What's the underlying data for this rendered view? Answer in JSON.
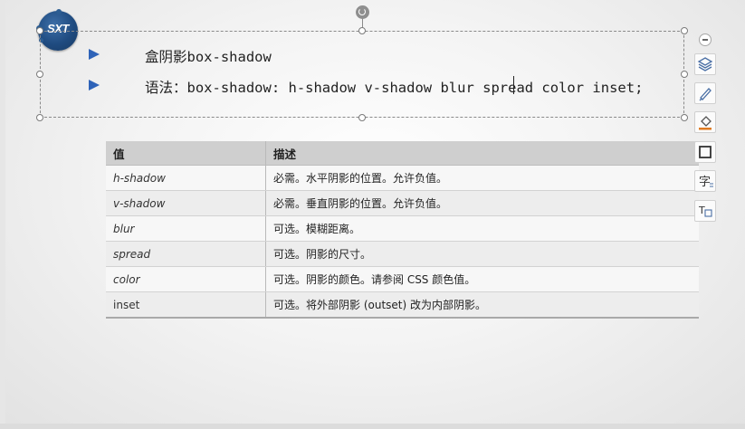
{
  "logo": {
    "text": "SXT"
  },
  "slide": {
    "bullets": [
      {
        "text": "盒阴影box-shadow"
      },
      {
        "text": "语法：box-shadow: h-shadow v-shadow blur spread color inset;"
      }
    ]
  },
  "table": {
    "headers": [
      "值",
      "描述"
    ],
    "rows": [
      {
        "value": "h-shadow",
        "desc": "必需。水平阴影的位置。允许负值。"
      },
      {
        "value": "v-shadow",
        "desc": "必需。垂直阴影的位置。允许负值。"
      },
      {
        "value": "blur",
        "desc": "可选。模糊距离。"
      },
      {
        "value": "spread",
        "desc": "可选。阴影的尺寸。"
      },
      {
        "value": "color",
        "desc": "可选。阴影的颜色。请参阅 CSS 颜色值。"
      },
      {
        "value": "inset",
        "desc": "可选。将外部阴影 (outset) 改为内部阴影。"
      }
    ]
  },
  "toolbar": {
    "items": [
      {
        "icon": "layers-icon"
      },
      {
        "icon": "pen-icon"
      },
      {
        "icon": "fill-icon"
      },
      {
        "icon": "outline-icon"
      },
      {
        "icon": "text-style-icon",
        "glyph": "字"
      },
      {
        "icon": "text-fit-icon",
        "glyph": "T"
      }
    ]
  },
  "colors": {
    "bullet": "#2e63b8",
    "logo": "#1f4b80",
    "header": "#cfcfcf",
    "accent_orange": "#e07b22"
  }
}
